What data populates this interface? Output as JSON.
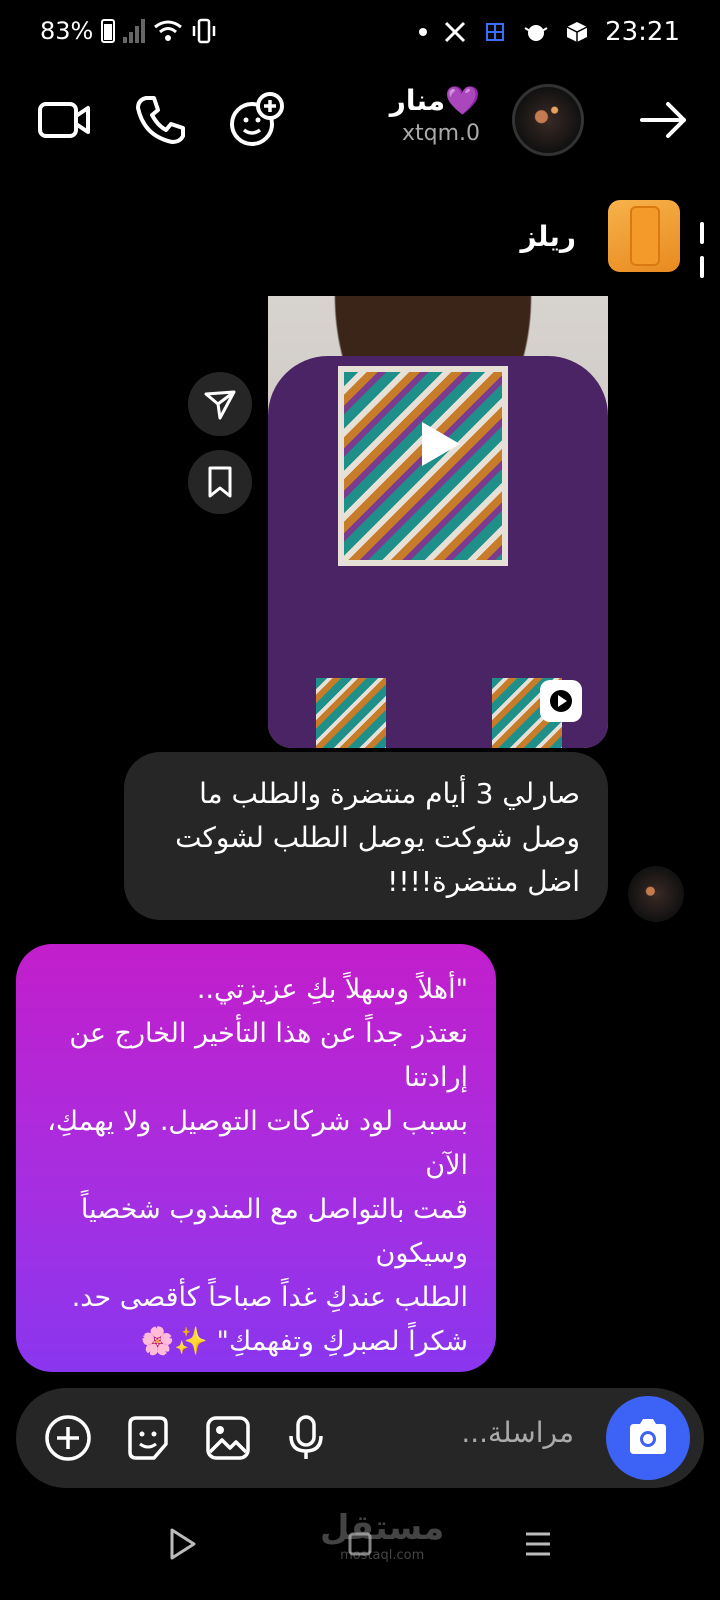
{
  "status_bar": {
    "battery": "83%",
    "time": "23:21"
  },
  "header": {
    "contact_name": "منار💜",
    "contact_username": "xtqm.0"
  },
  "reels": {
    "label": "ريلز"
  },
  "messages": {
    "incoming": "صارلي 3 أيام منتضرة والطلب ما وصل شوكت يوصل الطلب لشوكت اضل منتضرة!!!!",
    "outgoing": "\"أهلاً وسهلاً بكِ عزيزتي..\nنعتذر جداً عن هذا التأخير الخارج عن إرادتنا\nبسبب لود شركات التوصيل. ولا يهمكِ، الآن\nقمت بالتواصل مع المندوب شخصياً وسيكون\nالطلب عندكِ غداً صباحاً كأقصى حد.\nشكراً لصبركِ وتفهمكِ\" ✨🌸"
  },
  "composer": {
    "placeholder": "مراسلة..."
  },
  "watermark": {
    "arabic": "مستقل",
    "latin": "mostaql.com"
  },
  "colors": {
    "background": "#000000",
    "incoming_bubble": "#262626",
    "outgoing_gradient_top": "#c21ecb",
    "outgoing_gradient_bottom": "#8a36ef",
    "camera_button": "#3d63f6"
  }
}
